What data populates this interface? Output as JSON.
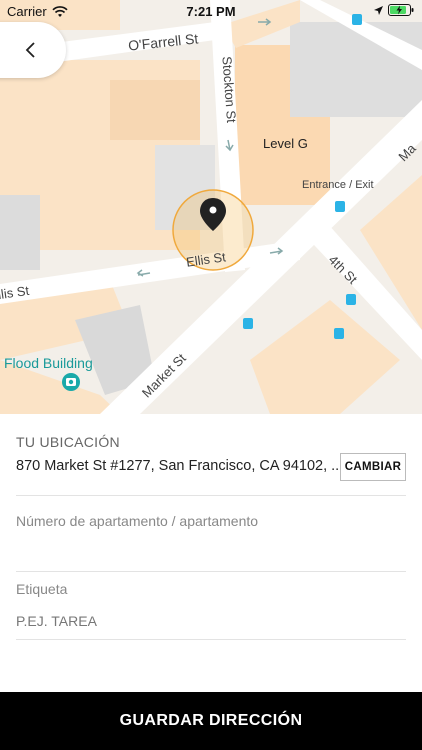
{
  "status_bar": {
    "carrier": "Carrier",
    "time": "7:21 PM",
    "icons": [
      "wifi-icon",
      "location-arrow-icon",
      "battery-charging-icon"
    ]
  },
  "map": {
    "streets": [
      "O'Farrell St",
      "Stockton St",
      "Ellis St",
      "Market St",
      "4th St"
    ],
    "short_street_label": "llis St",
    "places": [
      "Level G",
      "Entrance / Exit",
      "Flood Building"
    ],
    "pin_icon": "map-pin-icon"
  },
  "location_section": {
    "title": "TU UBICACIÓN",
    "address": "870 Market St #1277, San Francisco, CA 94102, ...",
    "change_button": "CAMBIAR"
  },
  "apartment_field": {
    "label": "Número de apartamento / apartamento",
    "value": ""
  },
  "tag_field": {
    "label": "Etiqueta",
    "placeholder": "P.EJ. TAREA"
  },
  "save_button": "GUARDAR DIRECCIÓN",
  "colors": {
    "map_background": "#f3efe9",
    "building": "#fde5c8",
    "pin_circle": "#f6b84e",
    "transit": "#2bb3e6",
    "button_background": "#000000"
  }
}
